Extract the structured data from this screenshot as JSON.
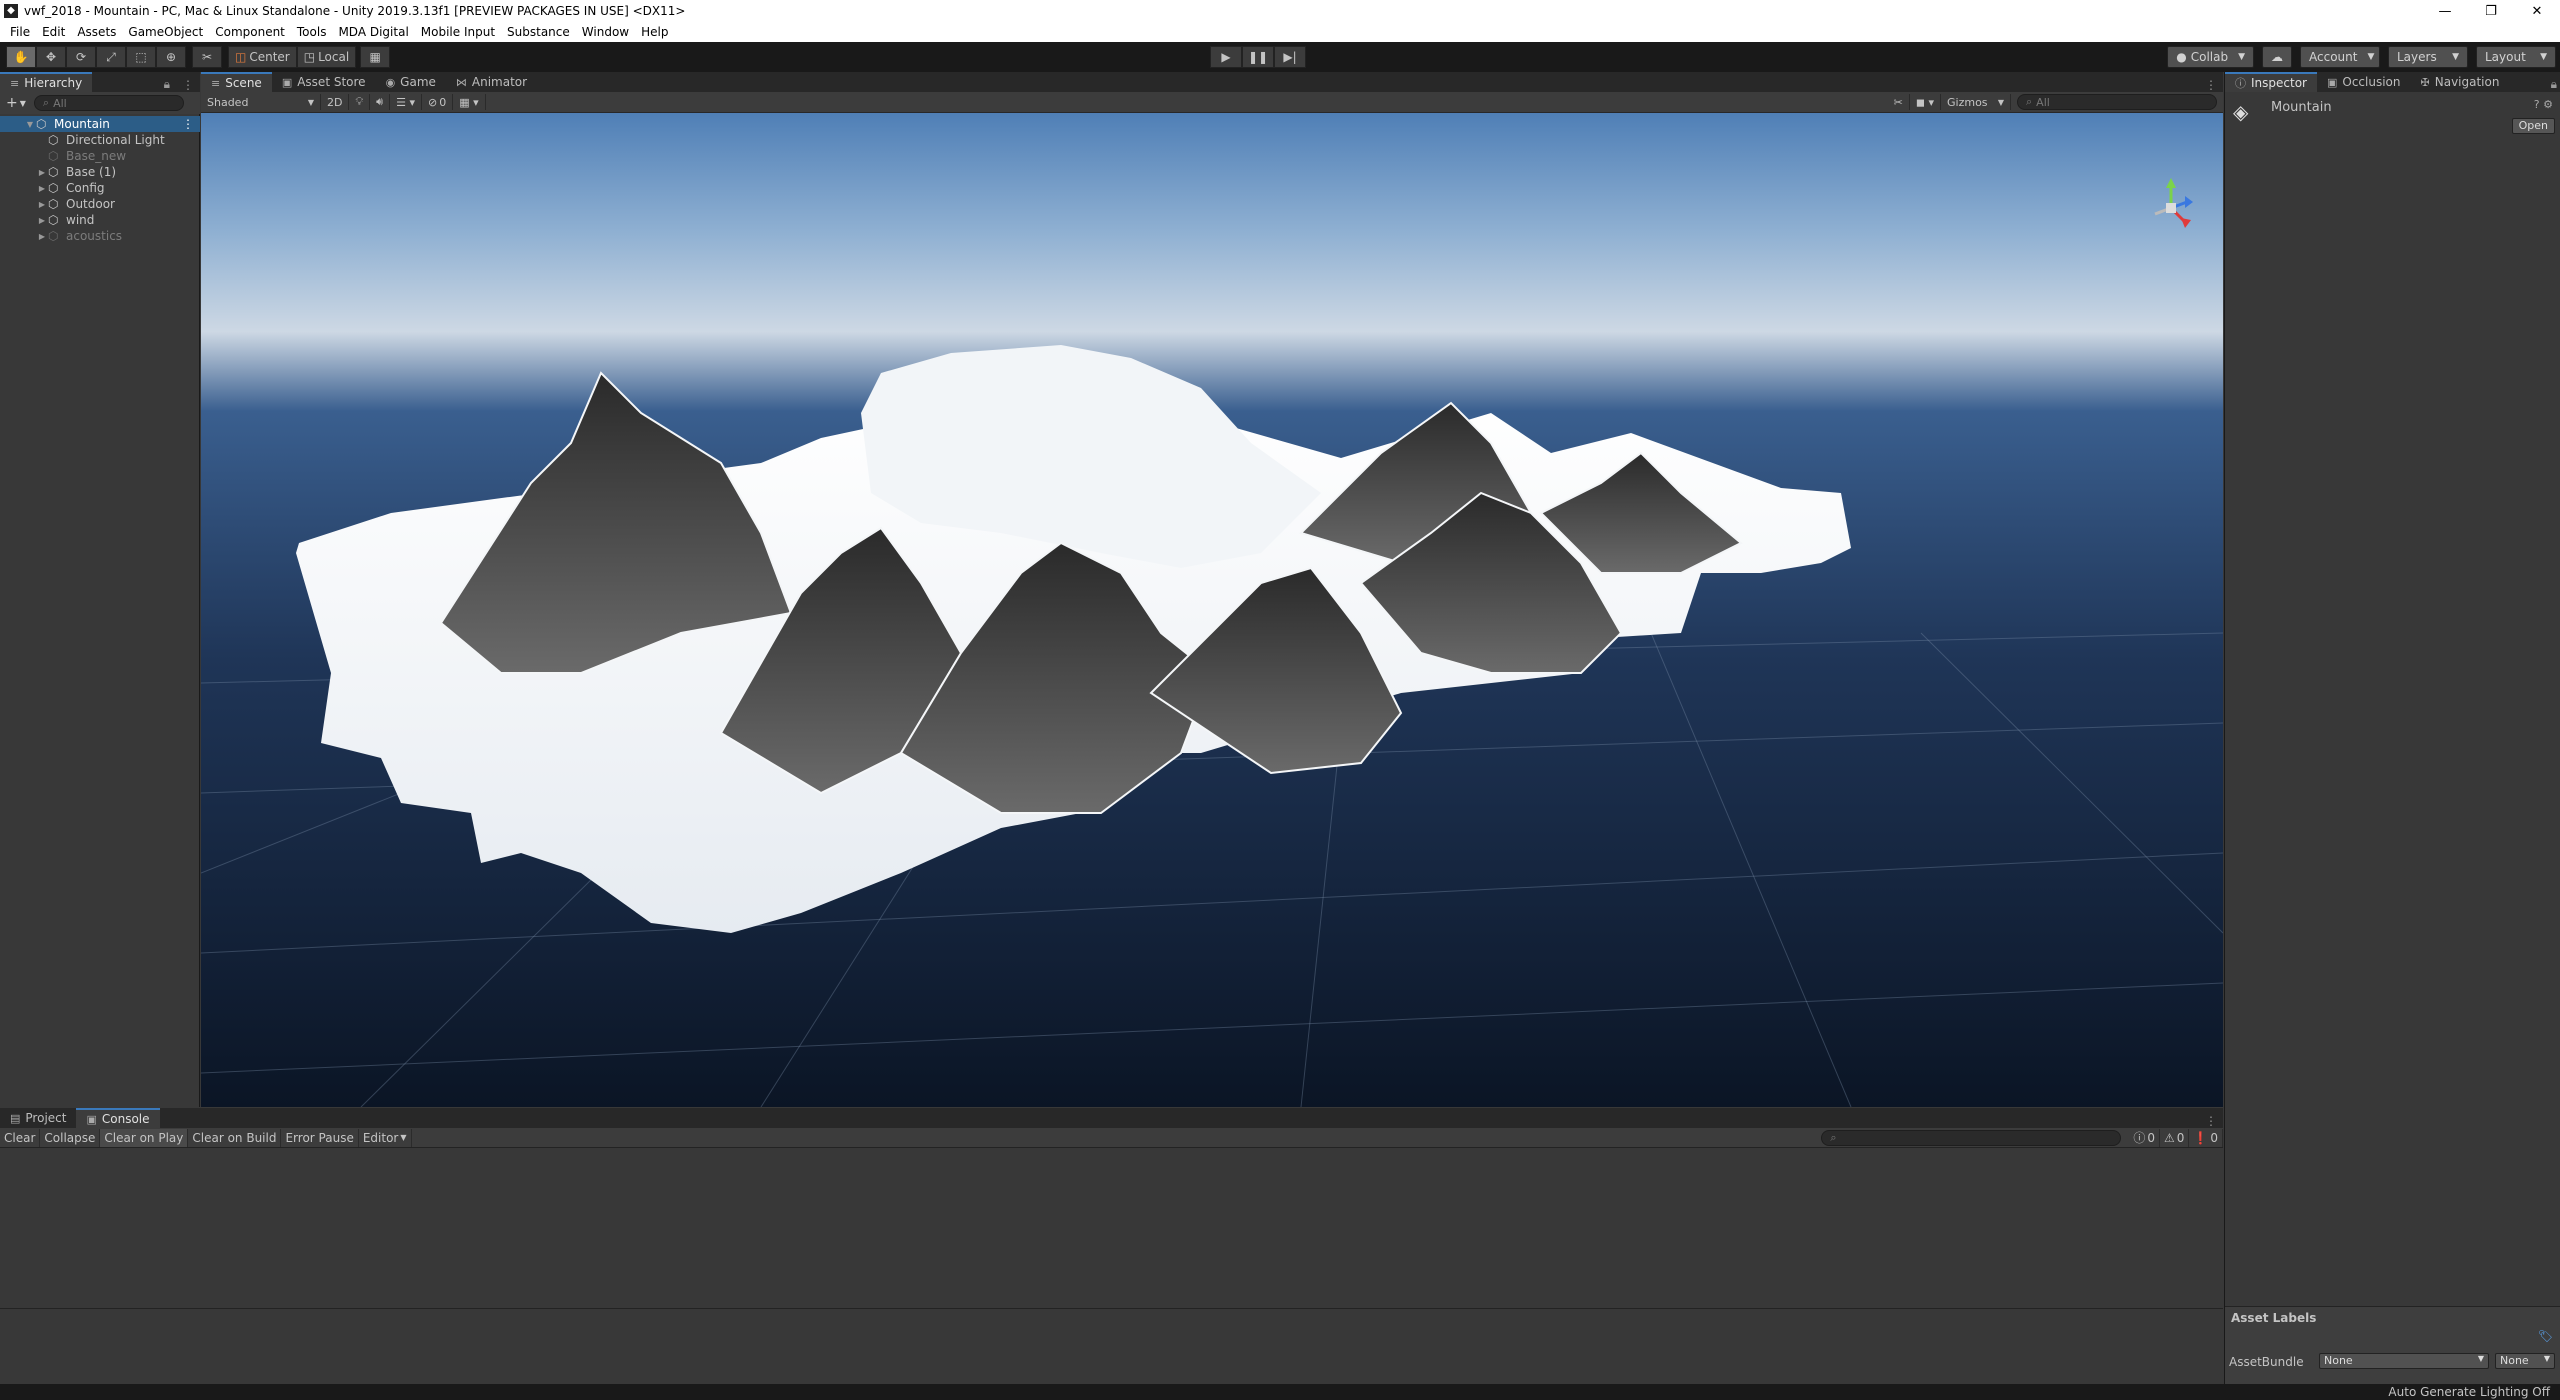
{
  "window": {
    "title": "vwf_2018 - Mountain - PC, Mac & Linux Standalone - Unity 2019.3.13f1 [PREVIEW PACKAGES IN USE] <DX11>",
    "minimize": "—",
    "maximize": "❐",
    "close": "✕"
  },
  "menu": [
    "File",
    "Edit",
    "Assets",
    "GameObject",
    "Component",
    "Tools",
    "MDA Digital",
    "Mobile Input",
    "Substance",
    "Window",
    "Help"
  ],
  "toolbar": {
    "pivot": "Center",
    "space": "Local",
    "collab": "Collab",
    "account": "Account",
    "layers": "Layers",
    "layout": "Layout"
  },
  "hierarchy": {
    "tab": "Hierarchy",
    "search_placeholder": "All",
    "items": [
      {
        "label": "Mountain",
        "depth": 0,
        "arrow": "▼",
        "selected": true,
        "dim": false
      },
      {
        "label": "Directional Light",
        "depth": 1,
        "arrow": "",
        "selected": false,
        "dim": false
      },
      {
        "label": "Base_new",
        "depth": 1,
        "arrow": "",
        "selected": false,
        "dim": true
      },
      {
        "label": "Base (1)",
        "depth": 1,
        "arrow": "▶",
        "selected": false,
        "dim": false
      },
      {
        "label": "Config",
        "depth": 1,
        "arrow": "▶",
        "selected": false,
        "dim": false
      },
      {
        "label": "Outdoor",
        "depth": 1,
        "arrow": "▶",
        "selected": false,
        "dim": false
      },
      {
        "label": "wind",
        "depth": 1,
        "arrow": "▶",
        "selected": false,
        "dim": false
      },
      {
        "label": "acoustics",
        "depth": 1,
        "arrow": "▶",
        "selected": false,
        "dim": true
      }
    ]
  },
  "scene_tabs": [
    "Scene",
    "Asset Store",
    "Game",
    "Animator"
  ],
  "scene_bar": {
    "shading": "Shaded",
    "mode_2d": "2D",
    "hidden_count": "0",
    "gizmos": "Gizmos",
    "search_placeholder": "All"
  },
  "inspector": {
    "tabs": [
      "Inspector",
      "Occlusion",
      "Navigation"
    ],
    "object_name": "Mountain",
    "open_button": "Open",
    "asset_labels": "Asset Labels",
    "asset_bundle_label": "AssetBundle",
    "asset_bundle_value": "None",
    "asset_variant_value": "None"
  },
  "console": {
    "tabs": [
      "Project",
      "Console"
    ],
    "buttons": [
      "Clear",
      "Collapse",
      "Clear on Play",
      "Clear on Build",
      "Error Pause",
      "Editor"
    ],
    "log_count": "0",
    "warning_count": "0",
    "error_count": "0"
  },
  "status": {
    "lighting": "Auto Generate Lighting Off"
  }
}
